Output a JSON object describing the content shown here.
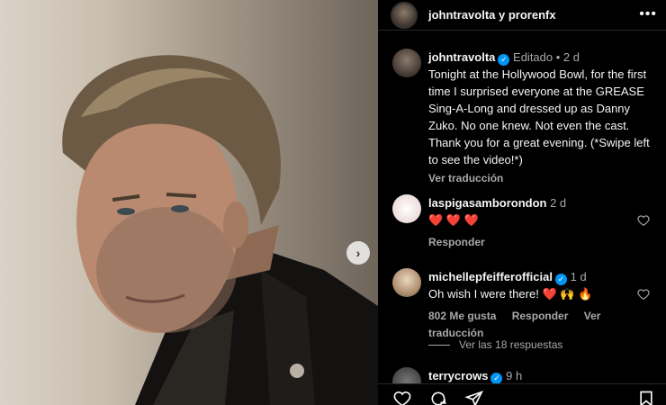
{
  "header": {
    "title": "johntravolta y prorenfx",
    "more_icon": "more-horizontal-icon"
  },
  "caption": {
    "username": "johntravolta",
    "meta": "Editado • 2 d",
    "text": "Tonight at the Hollywood Bowl, for the first time I surprised everyone at the GREASE Sing-A-Long and dressed up as Danny Zuko. No one knew. Not even the cast. Thank you for a great evening. (*Swipe left to see the video!*)",
    "see_translation": "Ver traducción"
  },
  "comments": [
    {
      "username": "laspigasamborondon",
      "time": "2 d",
      "text": "❤️ ❤️ ❤️",
      "reply": "Responder"
    },
    {
      "username": "michellepfeifferofficial",
      "time": "1 d",
      "text": "Oh wish I were there! ❤️ 🙌 🔥",
      "likes": "802 Me gusta",
      "reply": "Responder",
      "see_translation": "Ver traducción",
      "view_replies": "Ver las 18 respuestas"
    },
    {
      "username": "terrycrows",
      "time": "9 h"
    }
  ],
  "colors": {
    "verified": "#0095f6",
    "heart": "#ed4956",
    "muted": "#a8a8a8"
  },
  "icons": [
    "like-icon",
    "comment-icon",
    "share-icon",
    "save-icon",
    "next-arrow-icon"
  ]
}
